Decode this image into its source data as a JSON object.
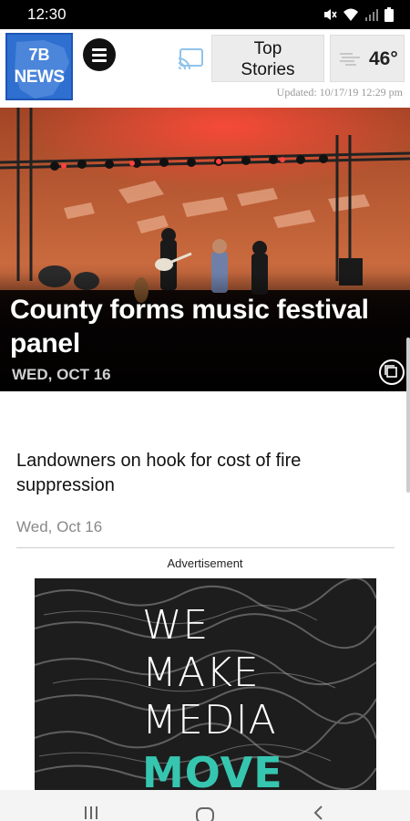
{
  "status_bar": {
    "time": "12:30"
  },
  "header": {
    "logo_number": "7B",
    "logo_word": "NEWS",
    "top_stories_line1": "Top",
    "top_stories_line2": "Stories",
    "weather_temp": "46°",
    "updated": "Updated: 10/17/19 12:29 pm"
  },
  "hero": {
    "title": "County forms music festival panel",
    "date": "WED, OCT 16"
  },
  "articles": [
    {
      "title": "Landowners on hook for cost of fire suppression",
      "date": "Wed, Oct 16"
    }
  ],
  "ad": {
    "label": "Advertisement",
    "lines": [
      "WE",
      "MAKE",
      "MEDIA",
      "MOVE"
    ]
  },
  "colors": {
    "logo_blue": "#2e6fd0",
    "ad_accent": "#36c6b0"
  }
}
